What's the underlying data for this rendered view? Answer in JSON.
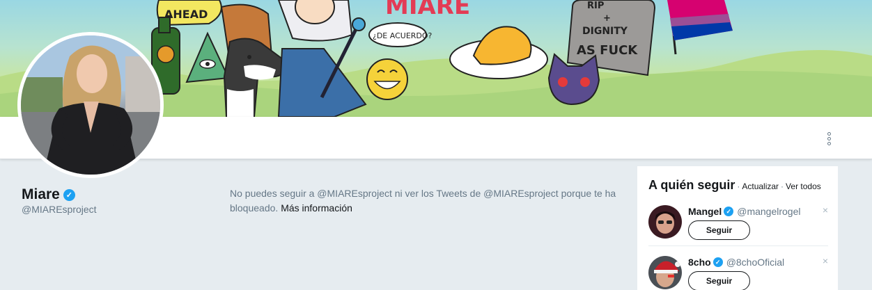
{
  "profile": {
    "name": "Miare",
    "handle": "@MIAREsproject",
    "verified_mark": "✓"
  },
  "banner": {
    "texts": [
      "AHEAD",
      "MIARE",
      "¿DE ACUERDO?",
      "RIP",
      "+",
      "DIGNITY",
      "AS FUCK"
    ]
  },
  "blocked_message": {
    "text": "No puedes seguir a @MIAREsproject ni ver los Tweets de @MIAREsproject porque te ha bloqueado.",
    "link": "Más información"
  },
  "who_to_follow": {
    "title": "A quién seguir",
    "separator": "·",
    "refresh": "Actualizar",
    "view_all": "Ver todos",
    "users": [
      {
        "name": "Mangel",
        "handle": "@mangelrogel",
        "button": "Seguir",
        "dismiss": "×"
      },
      {
        "name": "8cho",
        "handle": "@8choOficial",
        "button": "Seguir",
        "dismiss": "×"
      }
    ]
  },
  "icons": {
    "more": "more-vertical-icon",
    "verified": "verified-badge-icon",
    "dismiss": "close-icon"
  },
  "colors": {
    "background": "#e6ecf0",
    "verified": "#1da1f2",
    "muted_text": "#657786",
    "primary_text": "#14171a"
  }
}
